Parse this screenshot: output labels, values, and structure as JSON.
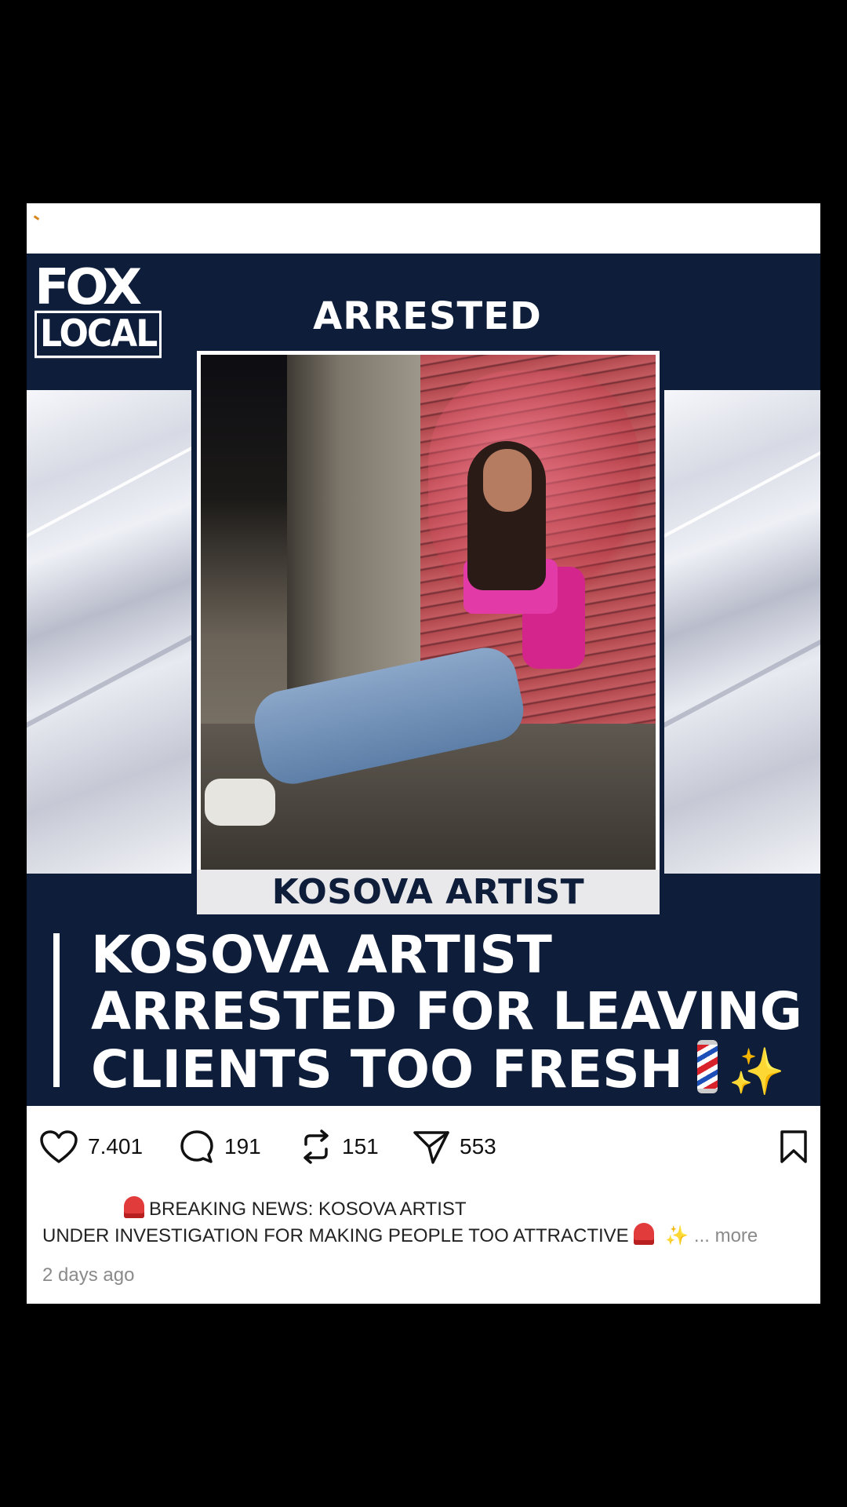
{
  "post": {
    "brand": {
      "line1": "FOX",
      "line2": "LOCAL"
    },
    "kicker": "ARRESTED",
    "photo_caption": "KOSOVA ARTIST",
    "headline": [
      "KOSOVA ARTIST",
      "ARRESTED FOR LEAVING",
      "CLIENTS TOO FRESH"
    ],
    "headline_emoji": [
      "barber-pole",
      "sparkles"
    ]
  },
  "actions": {
    "likes": "7.401",
    "comments": "191",
    "reposts": "151",
    "shares": "553"
  },
  "caption": {
    "line1": "BREAKING NEWS: KOSOVA ARTIST",
    "line2": "UNDER INVESTIGATION FOR MAKING PEOPLE TOO ATTRACTIVE",
    "more": "... more",
    "time": "2 days ago"
  },
  "colors": {
    "navy": "#0e1d3a",
    "siren": "#e23b3b",
    "muted": "#8a8a8a"
  }
}
